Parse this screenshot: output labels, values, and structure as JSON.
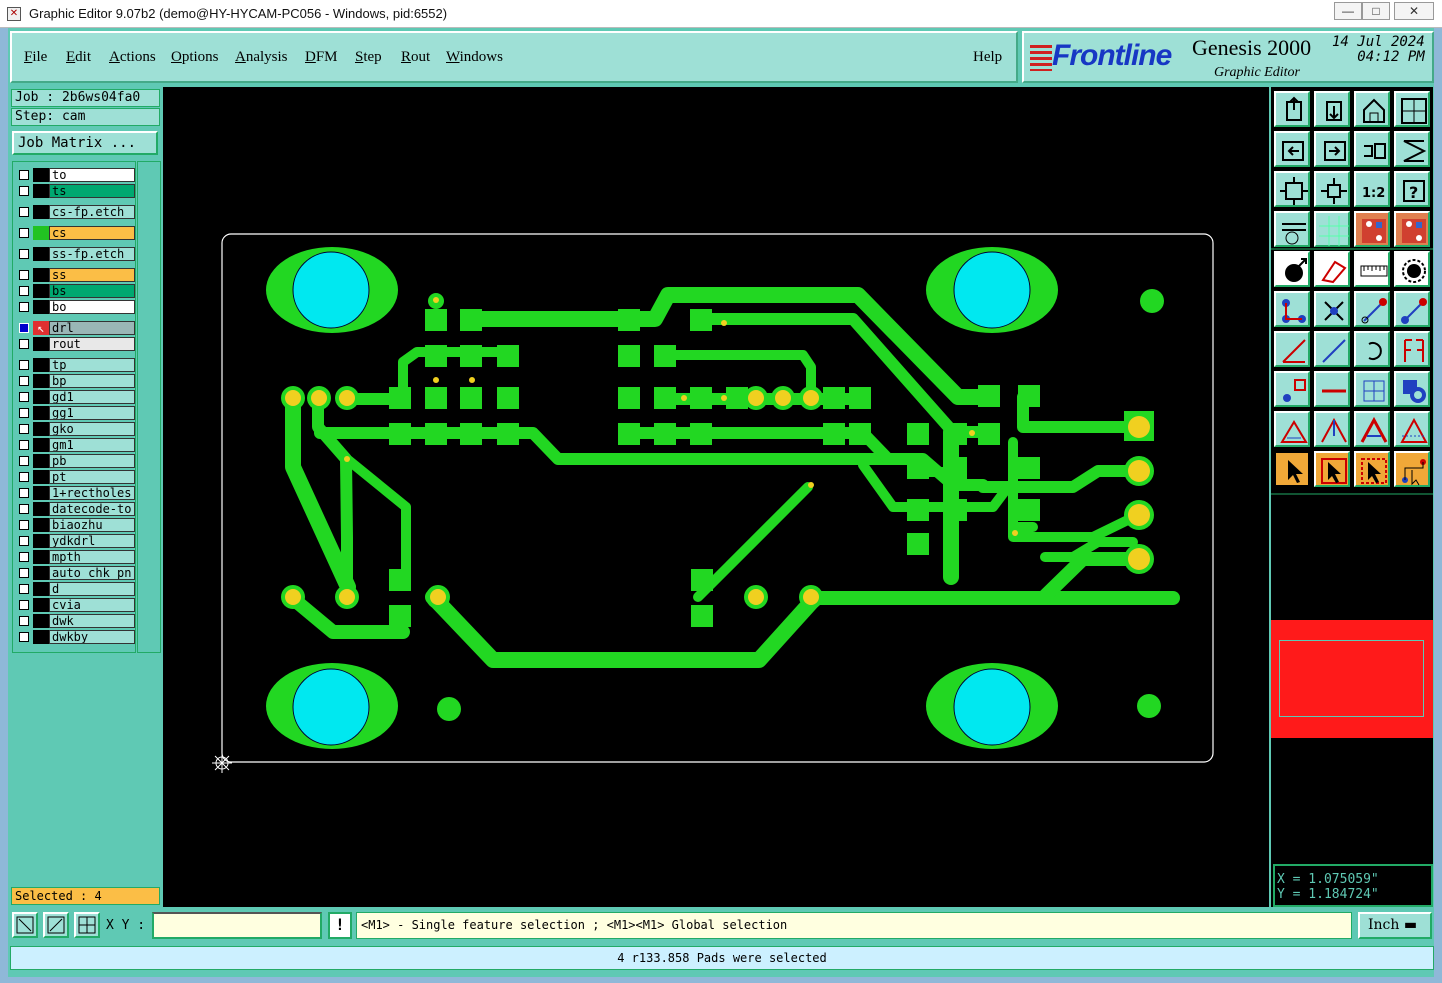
{
  "window": {
    "title": "Graphic Editor 9.07b2 (demo@HY-HYCAM-PC056 - Windows, pid:6552)",
    "minimize": "—",
    "maximize": "□",
    "close": "✕"
  },
  "menu": {
    "items": [
      "File",
      "Edit",
      "Actions",
      "Options",
      "Analysis",
      "DFM",
      "Step",
      "Rout",
      "Windows"
    ],
    "help": "Help"
  },
  "brand": {
    "logo": "Frontline",
    "product": "Genesis 2000",
    "subtitle": "Graphic Editor",
    "date": "14 Jul 2024",
    "time": "04:12 PM"
  },
  "job": {
    "job_label": "Job : 2b6ws04fa0",
    "step_label": "Step: cam",
    "matrix_button": "Job Matrix ..."
  },
  "layers": [
    {
      "name": "to",
      "color": "#ffffff"
    },
    {
      "name": "ts",
      "color": "#00a870"
    },
    {
      "name": "cs-fp.etch",
      "color": "#9ee0d6"
    },
    {
      "name": "cs",
      "color": "#fbbe46",
      "swatch": "#22c322"
    },
    {
      "name": "ss-fp.etch",
      "color": "#9ee0d6"
    },
    {
      "name": "ss",
      "color": "#fbbe46"
    },
    {
      "name": "bs",
      "color": "#00a870"
    },
    {
      "name": "bo",
      "color": "#ffffff"
    },
    {
      "name": "drl",
      "color": "#9ab6b6",
      "work": true
    },
    {
      "name": "rout",
      "color": "#e8e8e8"
    },
    {
      "name": "tp",
      "color": "#9ee0d6"
    },
    {
      "name": "bp",
      "color": "#9ee0d6"
    },
    {
      "name": "gd1",
      "color": "#9ee0d6"
    },
    {
      "name": "gg1",
      "color": "#9ee0d6"
    },
    {
      "name": "gko",
      "color": "#9ee0d6"
    },
    {
      "name": "gm1",
      "color": "#9ee0d6"
    },
    {
      "name": "pb",
      "color": "#9ee0d6"
    },
    {
      "name": "pt",
      "color": "#9ee0d6"
    },
    {
      "name": "1+rectholes",
      "color": "#9ee0d6"
    },
    {
      "name": "datecode-to",
      "color": "#9ee0d6"
    },
    {
      "name": "biaozhu",
      "color": "#9ee0d6"
    },
    {
      "name": "ydkdrl",
      "color": "#9ee0d6"
    },
    {
      "name": "mpth",
      "color": "#9ee0d6"
    },
    {
      "name": "auto_chk_pn",
      "color": "#9ee0d6"
    },
    {
      "name": "d",
      "color": "#9ee0d6"
    },
    {
      "name": "cvia",
      "color": "#9ee0d6"
    },
    {
      "name": "dwk",
      "color": "#9ee0d6"
    },
    {
      "name": "dwkby",
      "color": "#9ee0d6"
    }
  ],
  "selected": "Selected : 4",
  "coords": {
    "x": "X = 1.075059\"",
    "y": "Y = 1.184724\""
  },
  "status": {
    "xy_label": "X Y :",
    "xy_value": "",
    "warn": "!",
    "prompt": "<M1> - Single feature selection ; <M1><M1> Global selection",
    "unit": "Inch ▬",
    "message": "4 r133.858 Pads were selected"
  },
  "colors": {
    "copper": "#22d722",
    "pad": "#f0d020",
    "hole": "#00e8f0",
    "canvas": "#000000",
    "panel": "#5fc9b4"
  },
  "tools": [
    "zoom-home-icon",
    "zoom-back-icon",
    "home-view-icon",
    "window-icon",
    "pan-left-icon",
    "pan-right-icon",
    "undo-view-icon",
    "redraw-icon",
    "fit-all-icon",
    "fit-center-icon",
    "scale-1-2-icon",
    "query-icon",
    "measure-icon",
    "grid-icon",
    "snap-icon",
    "snap-center-icon",
    "select-pad-icon",
    "shape-icon",
    "ruler-icon",
    "circle-icon",
    "connect-icon",
    "cross-icon",
    "route-icon",
    "route-end-icon",
    "line-icon",
    "slash-icon",
    "arc-icon",
    "mirror-icon",
    "pad-move-icon",
    "segment-icon",
    "center-pad-icon",
    "copy-icon",
    "triangle-icon",
    "arrow-triangle-icon",
    "frame-icon",
    "hatch-icon",
    "pointer-icon",
    "pointer-box-icon",
    "pointer-select-icon",
    "pointer-net-icon"
  ]
}
